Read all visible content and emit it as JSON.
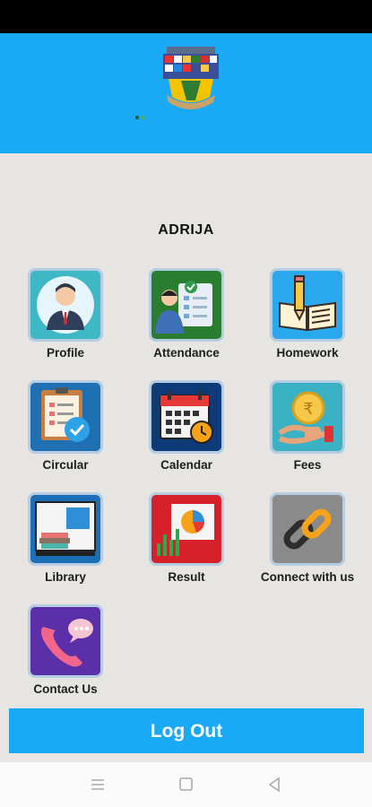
{
  "user": {
    "name": "ADRIJA"
  },
  "tiles": [
    {
      "label": "Profile",
      "icon": "profile-icon"
    },
    {
      "label": "Attendance",
      "icon": "attendance-icon"
    },
    {
      "label": "Homework",
      "icon": "homework-icon"
    },
    {
      "label": "Circular",
      "icon": "circular-icon"
    },
    {
      "label": "Calendar",
      "icon": "calendar-icon"
    },
    {
      "label": "Fees",
      "icon": "fees-icon"
    },
    {
      "label": "Library",
      "icon": "library-icon"
    },
    {
      "label": "Result",
      "icon": "result-icon"
    },
    {
      "label": "Connect with us",
      "icon": "connect-icon"
    },
    {
      "label": "Contact Us",
      "icon": "contact-icon"
    }
  ],
  "actions": {
    "logout_label": "Log Out"
  },
  "colors": {
    "header": "#1aa9f5",
    "background": "#e6e5e2",
    "button": "#1aa9f5"
  }
}
